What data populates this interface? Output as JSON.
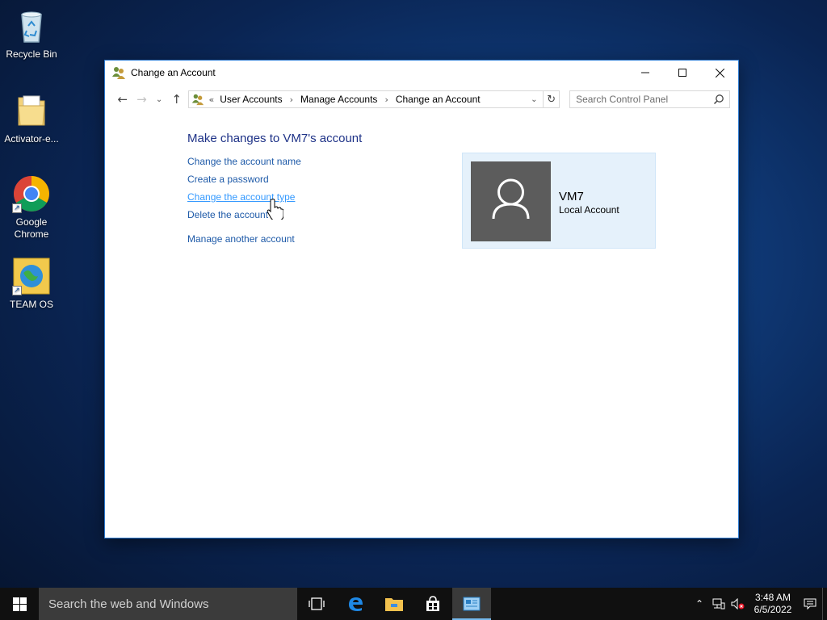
{
  "desktop": {
    "icons": [
      {
        "label": "Recycle Bin"
      },
      {
        "label": "Activator-e..."
      },
      {
        "label": "Google Chrome"
      },
      {
        "label": "TEAM OS"
      }
    ]
  },
  "window": {
    "title": "Change an Account",
    "icon": "user-accounts-icon",
    "address": {
      "overflow": "«",
      "crumbs": [
        "User Accounts",
        "Manage Accounts",
        "Change an Account"
      ]
    },
    "search_placeholder": "Search Control Panel",
    "heading": "Make changes to VM7's account",
    "tasks": [
      "Change the account name",
      "Create a password",
      "Change the account type",
      "Delete the account",
      "Manage another account"
    ],
    "account": {
      "name": "VM7",
      "type": "Local Account"
    }
  },
  "taskbar": {
    "search_placeholder": "Search the web and Windows",
    "clock_time": "3:48 AM",
    "clock_date": "6/5/2022"
  },
  "colors": {
    "link": "#1e5aa8",
    "link_hover": "#3399ff",
    "heading": "#1e3287",
    "card_bg": "#e5f1fb",
    "avatar_bg": "#5c5c5c",
    "taskbar_bg": "#101010"
  }
}
